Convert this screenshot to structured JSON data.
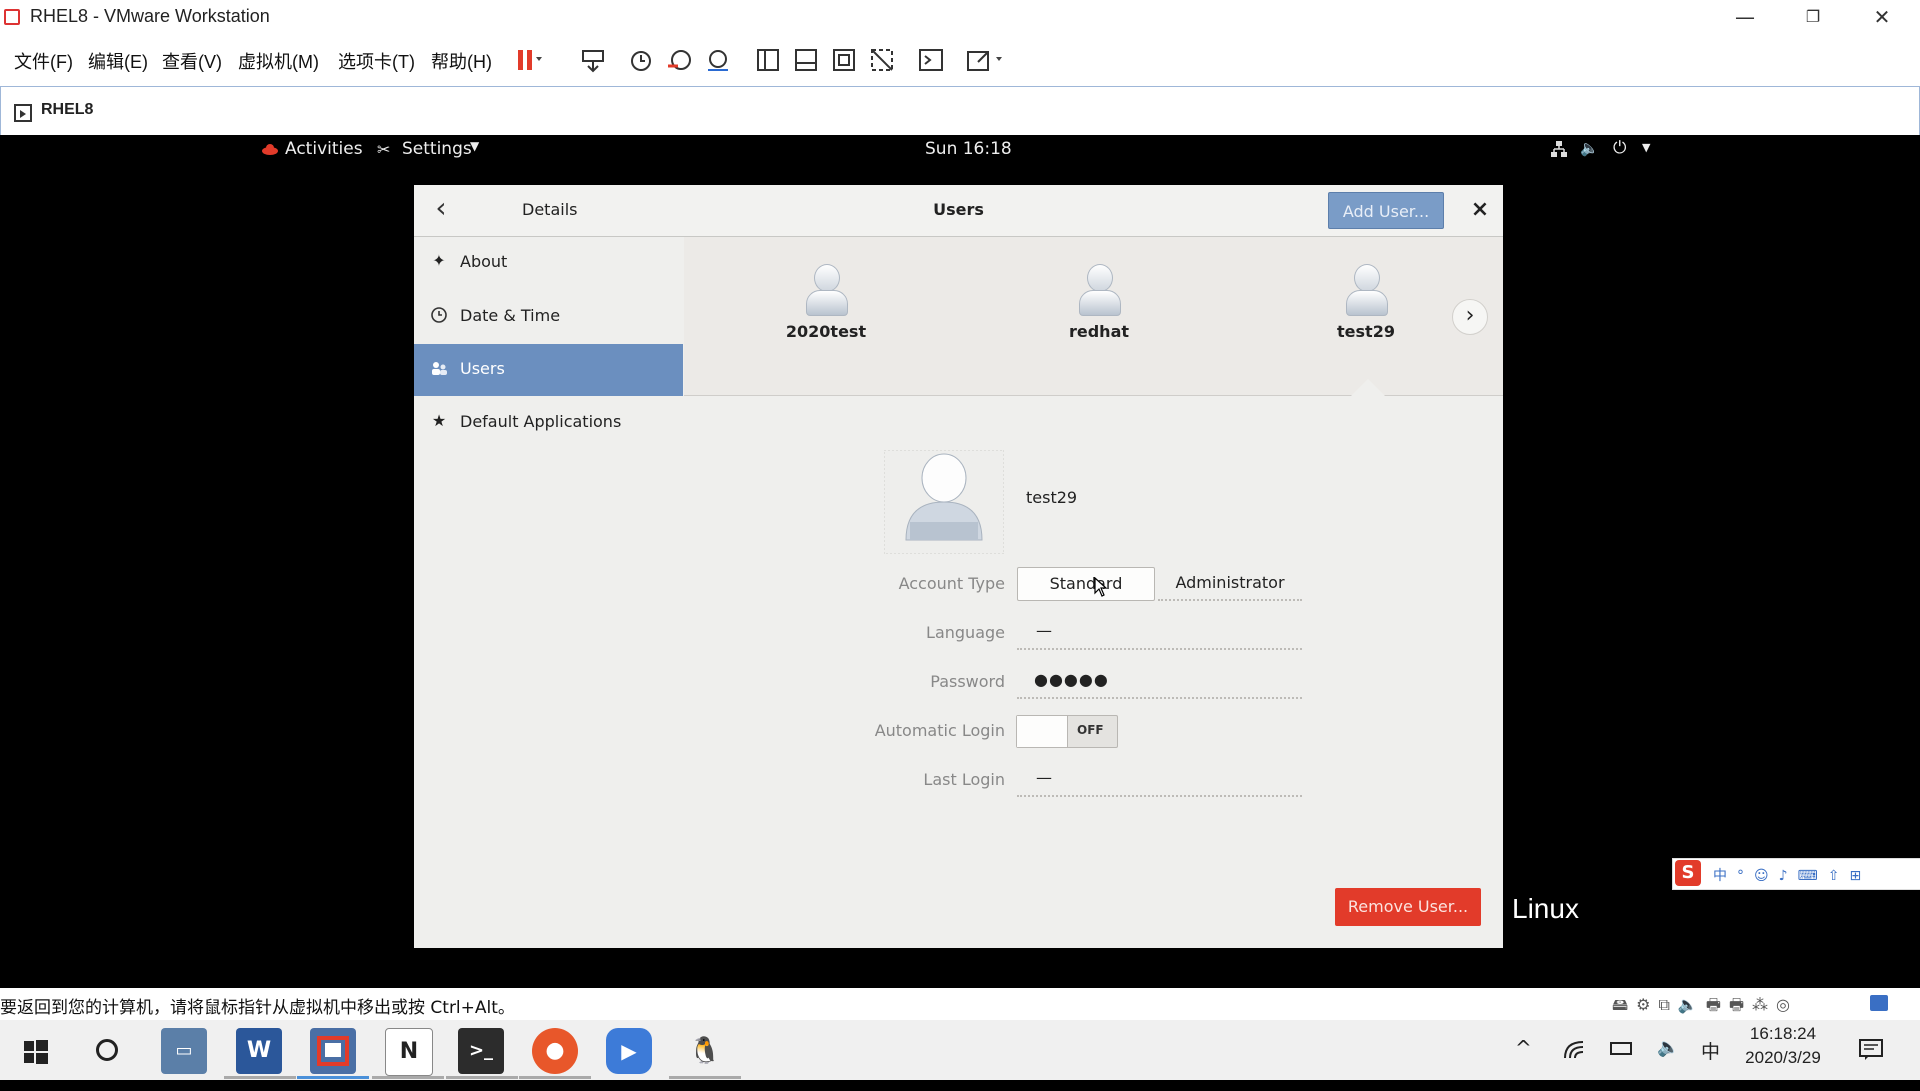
{
  "window": {
    "title": "RHEL8 - VMware Workstation",
    "minimize": "—",
    "restore": "❐",
    "close": "✕"
  },
  "menubar": {
    "items": [
      "文件(F)",
      "编辑(E)",
      "查看(V)",
      "虚拟机(M)",
      "选项卡(T)",
      "帮助(H)"
    ]
  },
  "tabbar": {
    "tab_label": "RHEL8"
  },
  "gnome": {
    "activities": "Activities",
    "settings_menu": "Settings",
    "clock": "Sun 16:18"
  },
  "settings": {
    "header": {
      "left_title": "Details",
      "center_title": "Users",
      "add_user": "Add User...",
      "close": "×",
      "back": "‹"
    },
    "sidebar": {
      "items": [
        {
          "label": "About",
          "icon": "star-icon"
        },
        {
          "label": "Date & Time",
          "icon": "clock-icon"
        },
        {
          "label": "Users",
          "icon": "users-icon",
          "selected": true
        },
        {
          "label": "Default Applications",
          "icon": "star-filled-icon"
        }
      ]
    },
    "users": [
      "2020test",
      "redhat",
      "test29"
    ],
    "selected_user": {
      "name": "test29",
      "account_type_label": "Account Type",
      "account_types": [
        "Standard",
        "Administrator"
      ],
      "language_label": "Language",
      "language": "—",
      "password_label": "Password",
      "password": "●●●●●",
      "autologin_label": "Automatic Login",
      "autologin": "OFF",
      "lastlogin_label": "Last Login",
      "lastlogin": "—"
    },
    "remove_user": "Remove User..."
  },
  "background_text": "Linux",
  "host_status": {
    "hint": "要返回到您的计算机，请将鼠标指针从虚拟机中移出或按 Ctrl+Alt。"
  },
  "taskbar": {
    "time": "16:18:24",
    "date": "2020/3/29",
    "ime_lang": "中"
  },
  "colors": {
    "selection": "#6b8fbf",
    "remove_button": "#e23b2a",
    "add_button": "#7a9cc7"
  }
}
